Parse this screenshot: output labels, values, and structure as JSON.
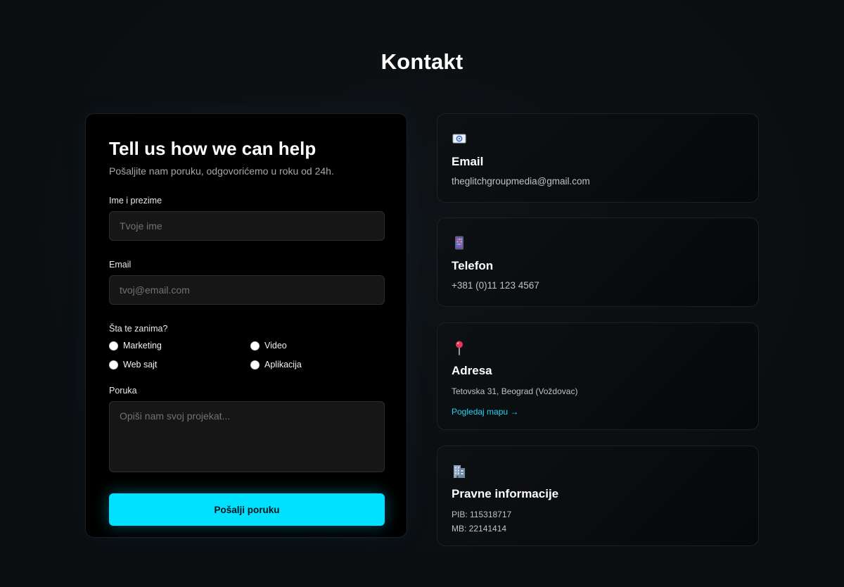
{
  "page": {
    "title": "Kontakt"
  },
  "form": {
    "heading": "Tell us how we can help",
    "subtitle": "Pošaljite nam poruku, odgovorićemo u roku od 24h.",
    "name": {
      "label": "Ime i prezime",
      "placeholder": "Tvoje ime",
      "value": ""
    },
    "email": {
      "label": "Email",
      "placeholder": "tvoj@email.com",
      "value": ""
    },
    "interest": {
      "label": "Šta te zanima?",
      "options": [
        "Marketing",
        "Video",
        "Web sajt",
        "Aplikacija"
      ],
      "selected": null
    },
    "message": {
      "label": "Poruka",
      "placeholder": "Opiši nam svoj projekat...",
      "value": ""
    },
    "submit_label": "Pošalji poruku"
  },
  "contact": {
    "email": {
      "icon": "email-icon",
      "title": "Email",
      "value": "theglitchgroupmedia@gmail.com"
    },
    "phone": {
      "icon": "mobile-phone-icon",
      "title": "Telefon",
      "value": "+381 (0)11 123 4567"
    },
    "address": {
      "icon": "location-pin-icon",
      "title": "Adresa",
      "value": "Tetovska 31, Beograd (Voždovac)",
      "map_link": "Pogledaj mapu →"
    },
    "legal": {
      "icon": "office-building-icon",
      "title": "Pravne informacije",
      "pib": "PIB: 115318717",
      "mb": "MB: 22141414"
    }
  },
  "colors": {
    "accent": "#00e0ff",
    "background": "#0c0f12",
    "card": "#000000"
  }
}
